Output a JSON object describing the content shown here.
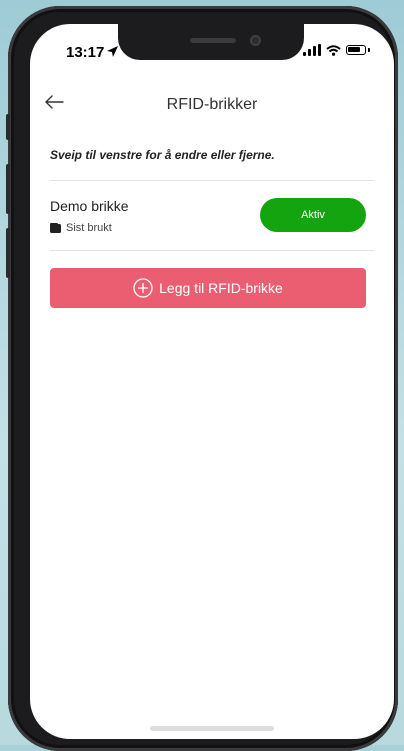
{
  "status_bar": {
    "time": "13:17"
  },
  "header": {
    "title": "RFID-brikker",
    "back_icon": "arrow-left-icon"
  },
  "hint": "Sveip til venstre for å endre eller fjerne.",
  "tags": [
    {
      "name": "Demo brikke",
      "sub_label": "Sist brukt",
      "sub_icon": "wallet-icon",
      "status": "Aktiv",
      "status_color": "#14a40f"
    }
  ],
  "add_button": {
    "label": "Legg til RFID-brikke",
    "icon": "plus-circle-icon",
    "color": "#eb5e72"
  }
}
